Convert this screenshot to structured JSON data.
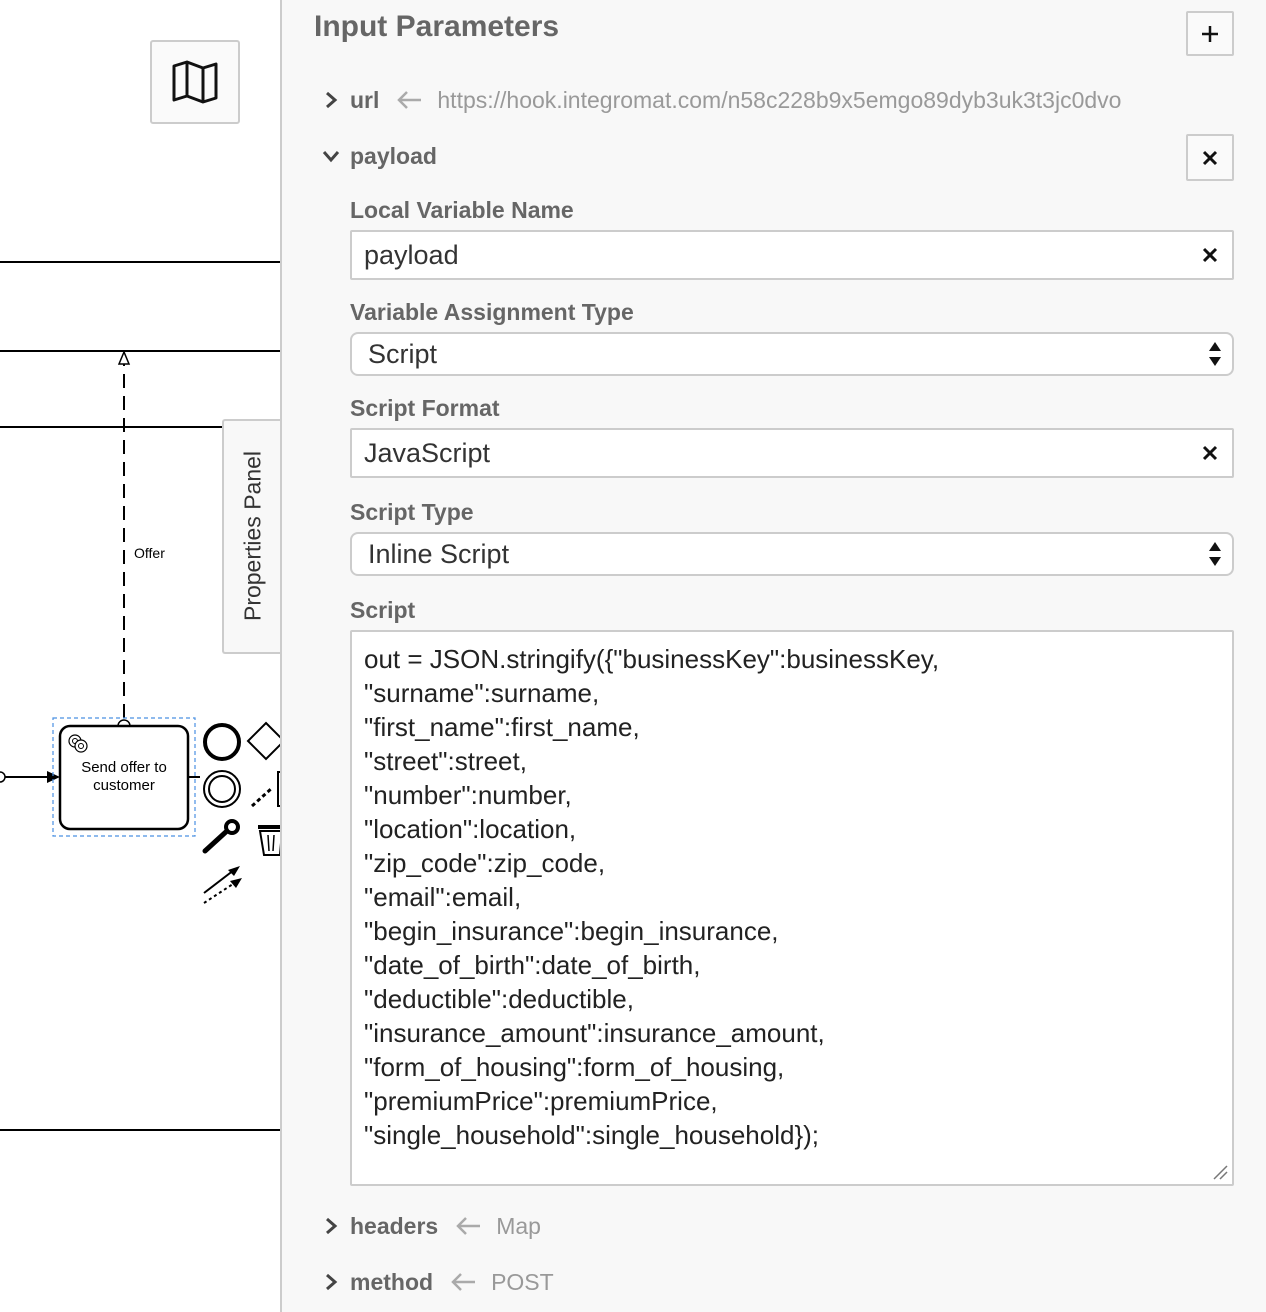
{
  "diagram": {
    "task_label_line1": "Send offer to",
    "task_label_line2": "customer",
    "flow_label": "Offer",
    "minimap_icon": "map-icon",
    "context_pad_icons": [
      "start-event-icon",
      "gateway-icon",
      "intermediate-event-icon",
      "text-annotation-icon",
      "wrench-icon",
      "trash-icon",
      "connect-icon"
    ]
  },
  "properties_tab": {
    "label": "Properties Panel"
  },
  "panel": {
    "section_title": "Input Parameters",
    "add_icon": "plus-icon",
    "params": [
      {
        "name": "url",
        "value": "https://hook.integromat.com/n58c228b9x5emgo89dyb3uk3t3jc0dvo",
        "expanded": false
      },
      {
        "name": "payload",
        "value": "",
        "expanded": true
      },
      {
        "name": "headers",
        "value": "Map",
        "expanded": false
      },
      {
        "name": "method",
        "value": "POST",
        "expanded": false
      }
    ],
    "remove_icon": "close-icon",
    "payload_form": {
      "local_variable_label": "Local Variable Name",
      "local_variable_value": "payload",
      "assignment_type_label": "Variable Assignment Type",
      "assignment_type_value": "Script",
      "script_format_label": "Script Format",
      "script_format_value": "JavaScript",
      "script_type_label": "Script Type",
      "script_type_value": "Inline Script",
      "script_label": "Script",
      "script_value": "out = JSON.stringify({\"businessKey\":businessKey,\n\"surname\":surname,\n\"first_name\":first_name,\n\"street\":street,\n\"number\":number,\n\"location\":location,\n\"zip_code\":zip_code,\n\"email\":email,\n\"begin_insurance\":begin_insurance,\n\"date_of_birth\":date_of_birth,\n\"deductible\":deductible,\n\"insurance_amount\":insurance_amount,\n\"form_of_housing\":form_of_housing,\n\"premiumPrice\":premiumPrice,\n\"single_household\":single_household});"
    }
  }
}
